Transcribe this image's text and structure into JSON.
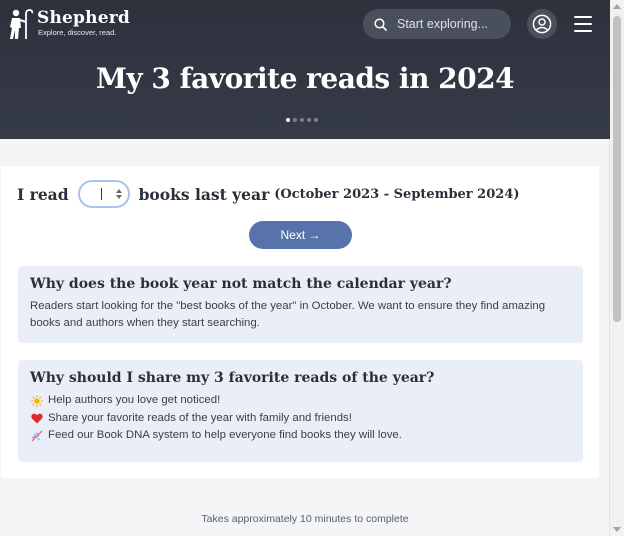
{
  "header": {
    "brand_name": "Shepherd",
    "brand_tagline": "Explore, discover, read.",
    "search_placeholder": "Start exploring...",
    "title": "My 3 favorite reads in 2024",
    "carousel": {
      "total": 5,
      "active_index": 0
    }
  },
  "form": {
    "prefix": "I read",
    "books_count_value": "",
    "suffix": "books last year",
    "range": "(October 2023 - September 2024)",
    "next_label": "Next →"
  },
  "faq_book_year": {
    "title": "Why does the book year not match the calendar year?",
    "body": "Readers start looking for the \"best books of the year\" in October. We want to ensure they find amazing books and authors when they start searching."
  },
  "faq_share": {
    "title": "Why should I share my 3 favorite reads of the year?",
    "items": [
      {
        "icon": "sun-icon",
        "text": "Help authors you love get noticed!"
      },
      {
        "icon": "heart-icon",
        "text": "Share your favorite reads of the year with family and friends!"
      },
      {
        "icon": "dna-icon",
        "text": "Feed our Book DNA system to help everyone find books they will love."
      }
    ]
  },
  "footer": {
    "note": "Takes approximately 10 minutes to complete"
  },
  "colors": {
    "hero_bg": "#2d313c",
    "button": "#5872ac",
    "info_bg": "#e9eef8",
    "input_border": "#a9c3ec"
  }
}
